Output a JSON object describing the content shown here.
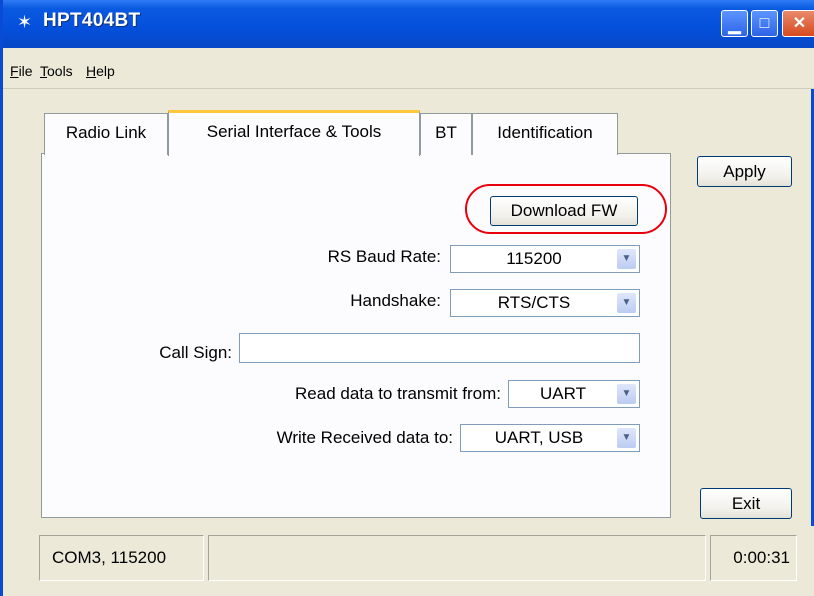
{
  "window": {
    "title": "HPT404BT",
    "title_icon": "app-icon",
    "accent": "#0550dc"
  },
  "titlebar_buttons": {
    "minimize": "minimize-icon",
    "maximize": "maximize-icon",
    "close": "close-icon"
  },
  "menu": {
    "items": [
      {
        "label": "File",
        "mnemonic": "F",
        "rest": "ile"
      },
      {
        "label": "Tools",
        "mnemonic": "T",
        "rest": "ools"
      },
      {
        "label": "Help",
        "mnemonic": "H",
        "rest": "elp"
      }
    ]
  },
  "tabs": [
    {
      "label": "Radio Link",
      "active": false
    },
    {
      "label": "Serial Interface & Tools",
      "active": true
    },
    {
      "label": "BT",
      "active": false
    },
    {
      "label": "Identification",
      "active": false
    }
  ],
  "panel": {
    "download_fw_label": "Download FW",
    "rs_baud_rate": {
      "label": "RS Baud Rate:",
      "value": "115200"
    },
    "handshake": {
      "label": "Handshake:",
      "value": "RTS/CTS"
    },
    "call_sign": {
      "label": "Call Sign:",
      "value": ""
    },
    "read_data": {
      "label": "Read data to transmit from:",
      "value": "UART"
    },
    "write_data": {
      "label": "Write Received data to:",
      "value": "UART, USB"
    }
  },
  "buttons": {
    "apply": "Apply",
    "exit": "Exit"
  },
  "status": {
    "port": "COM3, 115200",
    "middle": "",
    "time": "0:00:31"
  },
  "annotation": {
    "highlight_color": "#e8000c"
  }
}
